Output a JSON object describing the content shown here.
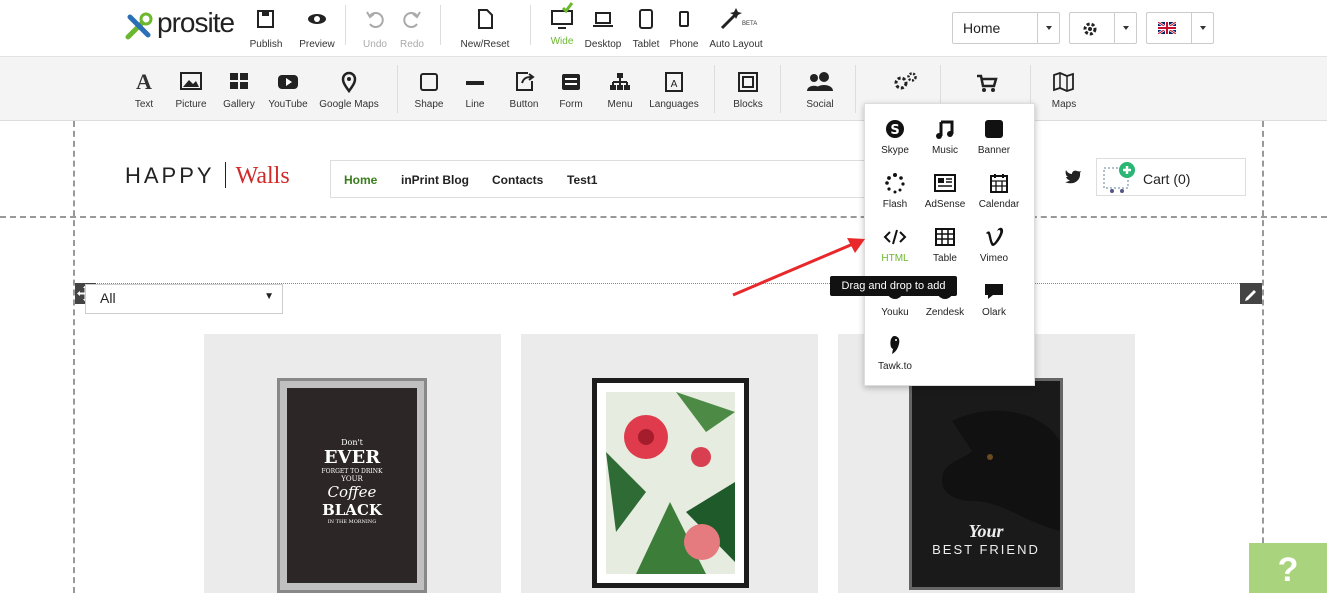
{
  "brand": {
    "logo_text": "prosite"
  },
  "top_toolbar": {
    "publish": "Publish",
    "preview": "Preview",
    "undo": "Undo",
    "redo": "Redo",
    "new_reset": "New/Reset",
    "wide": "Wide",
    "desktop": "Desktop",
    "tablet": "Tablet",
    "phone": "Phone",
    "auto_layout": "Auto Layout",
    "beta_badge": "BETA",
    "page_select": "Home"
  },
  "widget_toolbar": {
    "text": "Text",
    "picture": "Picture",
    "gallery": "Gallery",
    "youtube": "YouTube",
    "google_maps": "Google Maps",
    "shape": "Shape",
    "line": "Line",
    "button": "Button",
    "form": "Form",
    "menu": "Menu",
    "languages": "Languages",
    "blocks": "Blocks",
    "social": "Social",
    "maps": "Maps"
  },
  "site": {
    "logo_left": "HAPPY",
    "logo_right": "Walls",
    "nav": [
      "Home",
      "inPrint Blog",
      "Contacts",
      "Test1"
    ],
    "cart": "Cart (0)",
    "filter_value": "All"
  },
  "posters": [
    {
      "lines": [
        "Don't",
        "EVER",
        "FORGET TO DRINK",
        "YOUR",
        "Coffee",
        "BLACK",
        "IN THE MORNING"
      ]
    },
    {
      "lines": []
    },
    {
      "lines": [
        "Your",
        "BEST FRIEND"
      ]
    }
  ],
  "widgets_popup": {
    "items": [
      "Skype",
      "Music",
      "Banner",
      "Flash",
      "AdSense",
      "Calendar",
      "HTML",
      "Table",
      "Vimeo",
      "Youku",
      "Zendesk",
      "Olark",
      "Tawk.to"
    ],
    "tooltip": "Drag and drop to add",
    "highlight_color": "#6bb82e"
  },
  "help": {
    "label": "?"
  },
  "colors": {
    "accent_green": "#6bb82e",
    "brand_red": "#d02a2a",
    "help_green": "#a9d37d"
  }
}
